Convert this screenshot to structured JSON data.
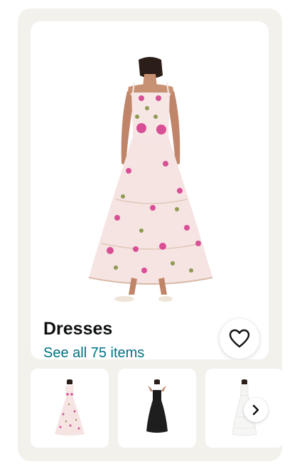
{
  "category": {
    "title": "Dresses",
    "see_all": "See all 75 items"
  },
  "icons": {
    "favorite": "heart-outline-icon",
    "next": "chevron-right-icon"
  },
  "thumbnails": [
    {
      "description": "floral-print-maxi-dress"
    },
    {
      "description": "black-strapless-dress"
    },
    {
      "description": "white-maxi-dress"
    }
  ],
  "colors": {
    "card_background": "#f3f1ec",
    "link": "#007185",
    "title": "#0f1111"
  }
}
